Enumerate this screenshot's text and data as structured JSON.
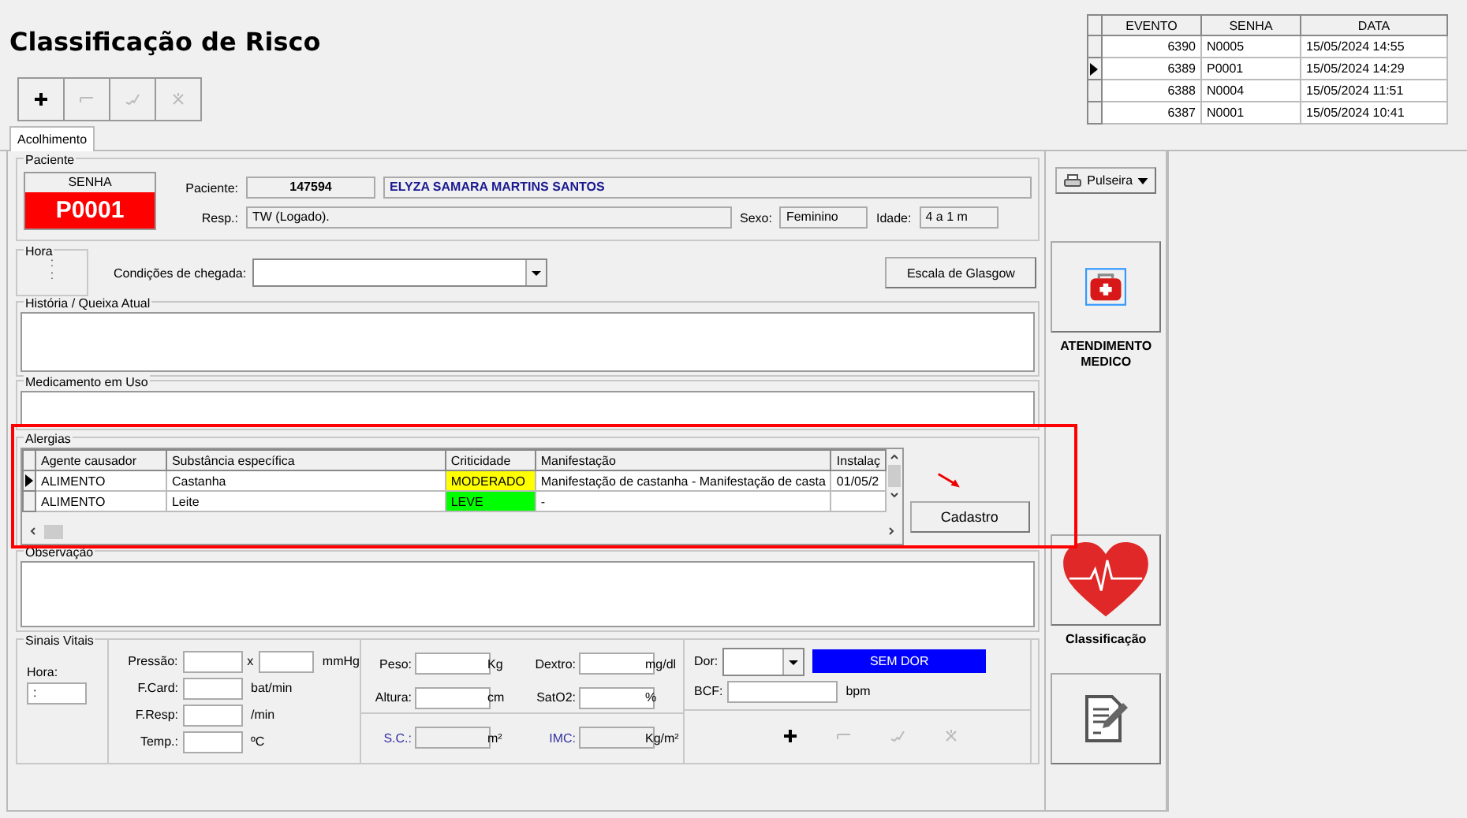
{
  "title": "Classificação de Risco",
  "toolbar": [
    {
      "kind": "plus",
      "disabled": false
    },
    {
      "kind": "minus",
      "disabled": true
    },
    {
      "kind": "check",
      "disabled": true
    },
    {
      "kind": "cross",
      "disabled": true
    }
  ],
  "events": {
    "columns": [
      "EVENTO",
      "SENHA",
      "DATA"
    ],
    "rows": [
      {
        "cells": [
          "6390",
          "N0005",
          "15/05/2024 14:55"
        ],
        "selected": false
      },
      {
        "cells": [
          "6389",
          "P0001",
          "15/05/2024 14:29"
        ],
        "selected": true
      },
      {
        "cells": [
          "6388",
          "N0004",
          "15/05/2024 11:51"
        ],
        "selected": false
      },
      {
        "cells": [
          "6387",
          "N0001",
          "15/05/2024 10:41"
        ],
        "selected": false
      }
    ]
  },
  "tabs": [
    {
      "label": "Acolhimento",
      "selected": true
    }
  ],
  "patient": {
    "legend": "Paciente",
    "senha_label": "SENHA",
    "senha": "P0001",
    "patient_label": "Paciente:",
    "id": "147594",
    "name": "ELYZA SAMARA MARTINS SANTOS",
    "resp_label": "Resp.:",
    "resp": "TW (Logado).",
    "sexo_label": "Sexo:",
    "sexo": "Feminino",
    "idade_label": "Idade:",
    "idade": "4 a 1 m"
  },
  "hora": {
    "legend": "Hora",
    "lines": [
      ":",
      ":"
    ]
  },
  "arrival": {
    "label": "Condições de chegada:"
  },
  "glasgow_button": "Escala de Glasgow",
  "history": {
    "legend": "História / Queixa Atual"
  },
  "medication": {
    "legend": "Medicamento em Uso"
  },
  "allergies": {
    "legend": "Alergias",
    "columns": [
      "Agente causador",
      "Substância específica",
      "Criticidade",
      "Manifestação",
      "Instalaç"
    ],
    "rows": [
      {
        "cells": [
          "ALIMENTO",
          "Castanha",
          "MODERADO",
          "Manifestação de castanha - Manifestação de casta",
          "01/05/2"
        ],
        "color": "#ffff00",
        "selected": true
      },
      {
        "cells": [
          "ALIMENTO",
          "Leite",
          "LEVE",
          "-",
          ""
        ],
        "color": "#00ff00",
        "selected": false
      }
    ],
    "button": "Cadastro"
  },
  "observation": {
    "legend": "Observação"
  },
  "vitals": {
    "legend": "Sinais Vitais",
    "hora_label": "Hora:",
    "hora_value": ":",
    "col1": [
      {
        "label": "Pressão:",
        "separator": "x",
        "unit": "mmHg"
      },
      {
        "label": "F.Card:",
        "unit": "bat/min"
      },
      {
        "label": "F.Resp:",
        "unit": "/min"
      },
      {
        "label": "Temp.:",
        "unit": "ºC"
      }
    ],
    "col2": [
      {
        "label": "Peso:",
        "unit": "Kg"
      },
      {
        "label": "Dextro:",
        "unit": "mg/dl"
      },
      {
        "label": "Altura:",
        "unit": "cm"
      },
      {
        "label": "SatO2:",
        "unit": "%"
      }
    ],
    "computed": [
      {
        "label": "S.C.:",
        "unit": "m²"
      },
      {
        "label": "IMC:",
        "unit": "Kg/m²"
      }
    ],
    "dor_label": "Dor:",
    "pain": {
      "label": "SEM DOR",
      "color": "#0000ff"
    },
    "bcf_label": "BCF:",
    "bcf_unit": "bpm",
    "toolbar": [
      {
        "kind": "plus",
        "disabled": false
      },
      {
        "kind": "minus",
        "disabled": true
      },
      {
        "kind": "check",
        "disabled": true
      },
      {
        "kind": "cross",
        "disabled": true
      }
    ]
  },
  "side": {
    "pulseira": "Pulseira",
    "buttons": [
      {
        "kind": "medic",
        "label": "ATENDIMENTO MEDICO"
      },
      {
        "kind": "heart",
        "label": "Classificação"
      },
      {
        "kind": "notes"
      }
    ]
  }
}
